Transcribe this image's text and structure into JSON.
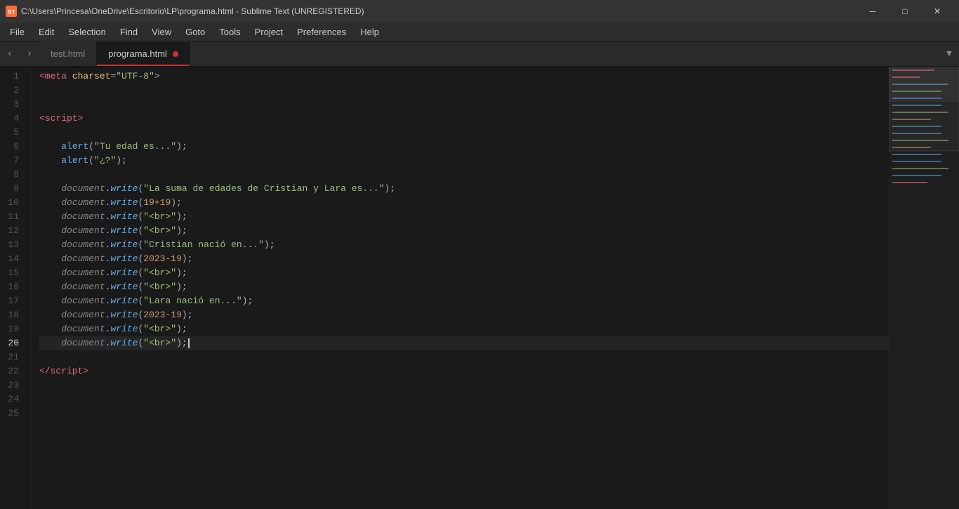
{
  "titlebar": {
    "icon": "ST",
    "path": "C:\\Users\\Princesa\\OneDrive\\Escritorio\\LP\\programa.html - Sublime Text (UNREGISTERED)",
    "minimize": "─",
    "maximize": "□",
    "close": "✕"
  },
  "menubar": {
    "items": [
      "File",
      "Edit",
      "Selection",
      "Find",
      "View",
      "Goto",
      "Tools",
      "Project",
      "Preferences",
      "Help"
    ]
  },
  "tabs": [
    {
      "id": "tab-test",
      "label": "test.html",
      "active": false,
      "dirty": false
    },
    {
      "id": "tab-programa",
      "label": "programa.html",
      "active": true,
      "dirty": true
    }
  ],
  "lines": [
    {
      "num": 1,
      "active": false
    },
    {
      "num": 2,
      "active": false
    },
    {
      "num": 3,
      "active": false
    },
    {
      "num": 4,
      "active": false
    },
    {
      "num": 5,
      "active": false
    },
    {
      "num": 6,
      "active": false
    },
    {
      "num": 7,
      "active": false
    },
    {
      "num": 8,
      "active": false
    },
    {
      "num": 9,
      "active": false
    },
    {
      "num": 10,
      "active": false
    },
    {
      "num": 11,
      "active": false
    },
    {
      "num": 12,
      "active": false
    },
    {
      "num": 13,
      "active": false
    },
    {
      "num": 14,
      "active": false
    },
    {
      "num": 15,
      "active": false
    },
    {
      "num": 16,
      "active": false
    },
    {
      "num": 17,
      "active": false
    },
    {
      "num": 18,
      "active": false
    },
    {
      "num": 19,
      "active": false
    },
    {
      "num": 20,
      "active": true
    },
    {
      "num": 21,
      "active": false
    },
    {
      "num": 22,
      "active": false
    },
    {
      "num": 23,
      "active": false
    },
    {
      "num": 24,
      "active": false
    },
    {
      "num": 25,
      "active": false
    }
  ]
}
